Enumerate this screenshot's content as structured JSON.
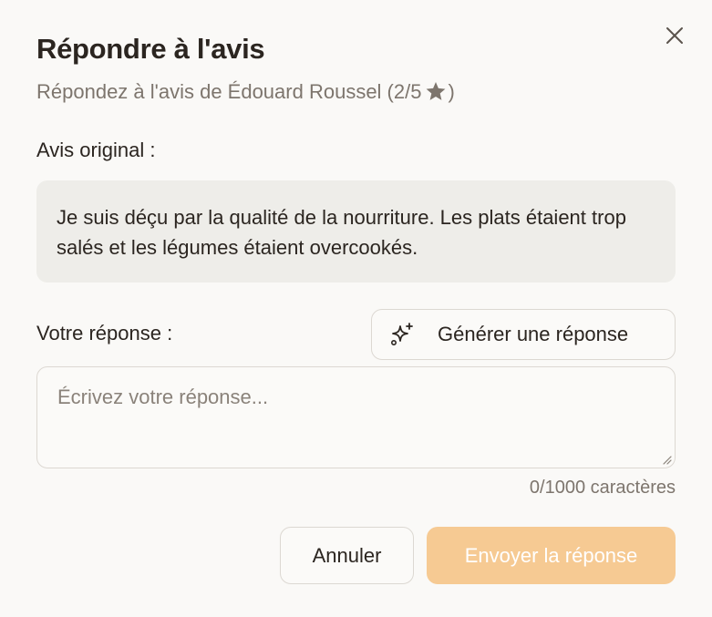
{
  "dialog": {
    "title": "Répondre à l'avis",
    "subtitle_prefix": "Répondez à l'avis de Édouard Roussel (2/5",
    "subtitle_suffix": ")",
    "rating": "2/5",
    "close_icon": "close-icon"
  },
  "original": {
    "label": "Avis original :",
    "text": "Je suis déçu par la qualité de la nourriture. Les plats étaient trop salés et les légumes étaient overcookés."
  },
  "response": {
    "label": "Votre réponse :",
    "generate_label": "Générer une réponse",
    "generate_icon": "sparkles-icon",
    "placeholder": "Écrivez votre réponse...",
    "value": "",
    "counter": "0/1000 caractères"
  },
  "actions": {
    "cancel_label": "Annuler",
    "send_label": "Envoyer la réponse"
  },
  "colors": {
    "background": "#faf9f7",
    "text": "#2b2520",
    "muted": "#7d756d",
    "original_bg": "#eeede9",
    "border": "#dcd8d2",
    "accent_disabled": "#f6ca93"
  }
}
